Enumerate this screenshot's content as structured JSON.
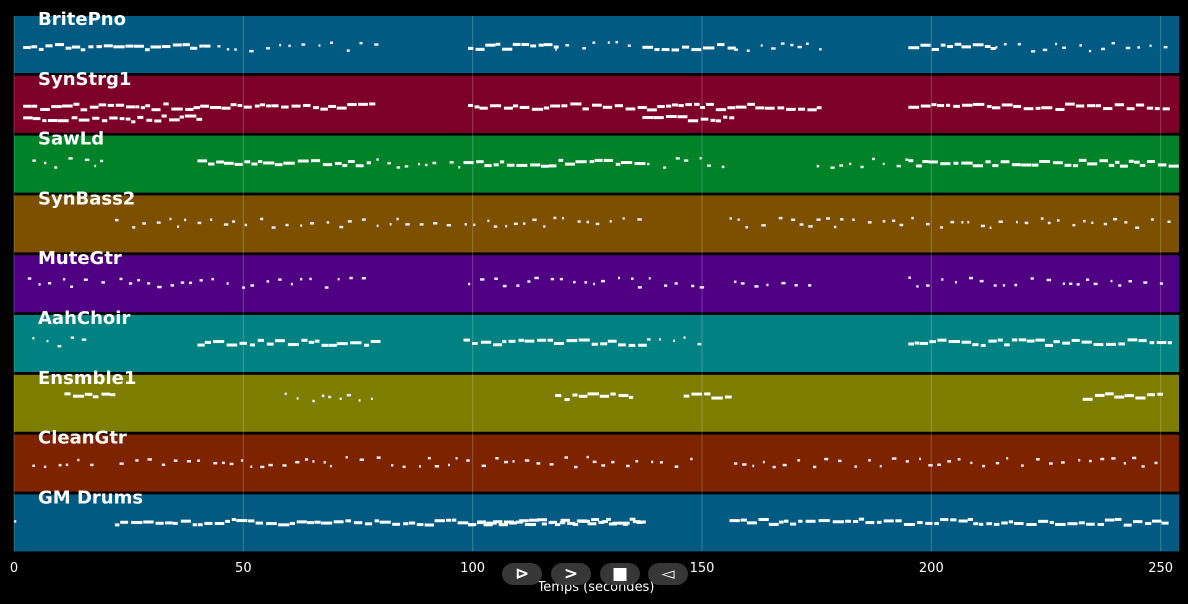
{
  "chart_data": {
    "type": "piano-roll",
    "xlabel": "Temps (secondes)",
    "xlim": [
      0,
      254
    ],
    "xticks": [
      0,
      50,
      100,
      150,
      200,
      250
    ],
    "grid": true,
    "tracks": [
      {
        "name": "BritePno",
        "color": "#005A82",
        "sections": [
          [
            2,
            41,
            "dense"
          ],
          [
            41,
            79,
            "sparse"
          ],
          [
            99,
            118,
            "dense"
          ],
          [
            118,
            136,
            "sparse"
          ],
          [
            137,
            157,
            "dense"
          ],
          [
            157,
            176,
            "sparse"
          ],
          [
            195,
            214,
            "dense"
          ],
          [
            214,
            251,
            "sparse"
          ]
        ]
      },
      {
        "name": "SynStrg1",
        "color": "#7D0028",
        "sections": [
          [
            2,
            79,
            "dense"
          ],
          [
            2,
            41,
            "dense"
          ],
          [
            99,
            176,
            "dense"
          ],
          [
            137,
            156,
            "dense"
          ],
          [
            195,
            251,
            "dense"
          ]
        ]
      },
      {
        "name": "SawLd",
        "color": "#008228",
        "sections": [
          [
            4,
            21,
            "sparse"
          ],
          [
            40,
            78,
            "dense"
          ],
          [
            79,
            98,
            "sparse"
          ],
          [
            98,
            137,
            "dense"
          ],
          [
            138,
            155,
            "sparse"
          ],
          [
            175,
            195,
            "sparse"
          ],
          [
            195,
            252,
            "dense"
          ]
        ]
      },
      {
        "name": "SynBass2",
        "color": "#7D5000",
        "sections": [
          [
            22,
            137,
            "sparse"
          ],
          [
            156,
            252,
            "sparse"
          ]
        ]
      },
      {
        "name": "MuteGtr",
        "color": "#500082",
        "sections": [
          [
            3,
            20,
            "sparse"
          ],
          [
            23,
            79,
            "sparse"
          ],
          [
            99,
            150,
            "sparse"
          ],
          [
            157,
            175,
            "sparse"
          ],
          [
            195,
            250,
            "sparse"
          ]
        ]
      },
      {
        "name": "AahChoir",
        "color": "#008282",
        "sections": [
          [
            4,
            16,
            "sparse"
          ],
          [
            40,
            78,
            "dense"
          ],
          [
            98,
            137,
            "dense"
          ],
          [
            138,
            150,
            "sparse"
          ],
          [
            195,
            252,
            "dense"
          ]
        ]
      },
      {
        "name": "Ensmble1",
        "color": "#7D7D00",
        "sections": [
          [
            11,
            21,
            "dense"
          ],
          [
            59,
            78,
            "sparse"
          ],
          [
            118,
            135,
            "dense"
          ],
          [
            146,
            156,
            "dense"
          ],
          [
            233,
            250,
            "dense"
          ]
        ]
      },
      {
        "name": "CleanGtr",
        "color": "#7D2300",
        "sections": [
          [
            4,
            18,
            "sparse"
          ],
          [
            23,
            150,
            "sparse"
          ],
          [
            157,
            250,
            "sparse"
          ]
        ]
      },
      {
        "name": "GM Drums",
        "color": "#005A82",
        "sections": [
          [
            0,
            1,
            "sparse"
          ],
          [
            22,
            137,
            "dense"
          ],
          [
            99,
            137,
            "dense"
          ],
          [
            156,
            251,
            "dense"
          ]
        ]
      }
    ]
  },
  "controls": {
    "play_label": "⊳",
    "forward_label": ">",
    "stop_label": "■",
    "back_label": "◅"
  }
}
